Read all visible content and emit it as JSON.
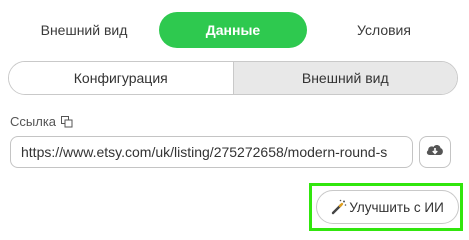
{
  "tabs": [
    {
      "label": "Внешний вид"
    },
    {
      "label": "Данные"
    },
    {
      "label": "Условия"
    }
  ],
  "segments": [
    {
      "label": "Конфигурация"
    },
    {
      "label": "Внешний вид"
    }
  ],
  "link_section": {
    "label": "Ссылка",
    "url_value": "https://www.etsy.com/uk/listing/275272658/modern-round-s"
  },
  "improve_button": {
    "label": "Улучшить с ИИ"
  },
  "colors": {
    "active_tab": "#2ec94f",
    "highlight": "#31e60d"
  },
  "icons": [
    "copy-icon",
    "cloud-download-icon",
    "magic-wand-icon"
  ]
}
